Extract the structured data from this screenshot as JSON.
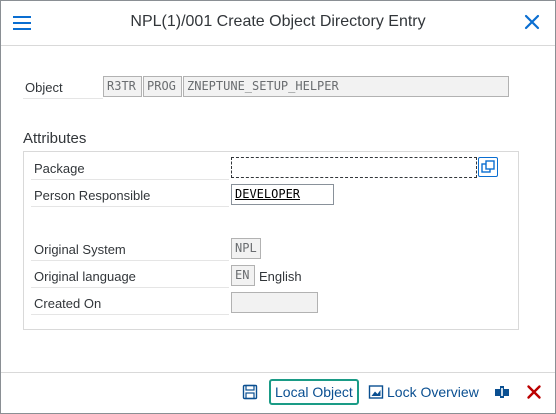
{
  "dialog": {
    "title": "NPL(1)/001 Create Object Directory Entry"
  },
  "object": {
    "label": "Object",
    "pgmid": "R3TR",
    "type": "PROG",
    "name": "ZNEPTUNE_SETUP_HELPER"
  },
  "attributes": {
    "heading": "Attributes",
    "package_label": "Package",
    "package_value": "",
    "person_label": "Person Responsible",
    "person_value": "DEVELOPER",
    "system_label": "Original System",
    "system_value": "NPL",
    "language_label": "Original language",
    "language_code": "EN",
    "language_name": "English",
    "created_label": "Created On",
    "created_value": ""
  },
  "footer": {
    "local_object_label": "Local Object",
    "lock_overview_label": "Lock Overview"
  },
  "colors": {
    "accent": "#0a6ed1",
    "primary_border": "#1a9b86",
    "cancel": "#bb0000"
  }
}
